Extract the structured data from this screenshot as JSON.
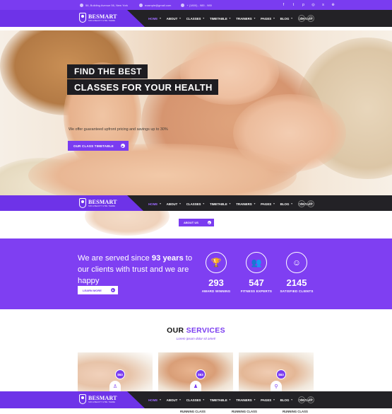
{
  "topbar": {
    "address": "56, Building Avenue 56, New York",
    "email": "example@gmail.com",
    "phone": "+ (1800) - 985 - 985",
    "social_icons": [
      "facebook-icon",
      "twitter-icon",
      "pinterest-icon",
      "instagram-icon",
      "skype-icon",
      "dribbble-icon"
    ]
  },
  "logo": {
    "brand": "BESMART",
    "tagline": "SPA & BEAUTY HTML THEME"
  },
  "nav": {
    "items": [
      {
        "label": "HOME",
        "active": true
      },
      {
        "label": "ABOUT"
      },
      {
        "label": "CLASSES"
      },
      {
        "label": "TIMETABLE"
      },
      {
        "label": "TRAINERS"
      },
      {
        "label": "PAGES"
      },
      {
        "label": "BLOG"
      },
      {
        "label": "CONTACT",
        "no_chevron": true
      }
    ],
    "icons": [
      "search-icon",
      "cart-icon"
    ]
  },
  "hero": {
    "line1": "FIND THE BEST",
    "line2": "CLASSES FOR YOUR HEALTH",
    "subtitle": "We offer guaranteed upfront pricing and savings up to 30%",
    "button": "OUR CLASS TIMETABLE"
  },
  "about": {
    "button": "ABOUT US"
  },
  "stats": {
    "headline_pre": "We are served since ",
    "headline_bold": "93 years",
    "headline_post": " to our clients with trust and we are happy",
    "button": "LEARN MORE",
    "items": [
      {
        "icon": "trophy-icon",
        "value": "293",
        "label": "AWARD WINNING"
      },
      {
        "icon": "team-icon",
        "value": "547",
        "label": "FITNESS EXPERTS"
      },
      {
        "icon": "smile-icon",
        "value": "2145",
        "label": "SATISFIED CLIENTS"
      }
    ]
  },
  "services": {
    "title_plain": "OUR ",
    "title_highlight": "SERVICES",
    "subtitle": "Lorem ipsum dolor sit amet!",
    "cards": [
      {
        "price": "$63",
        "icon": "yoga-icon"
      },
      {
        "price": "$63",
        "icon": "meditation-icon"
      },
      {
        "price": "$63",
        "icon": "fitness-icon"
      }
    ],
    "partial_labels": [
      "RUNNING CLASS",
      "RUNNING CLASS",
      "RUNNING CLASS"
    ]
  },
  "colors": {
    "accent": "#7a3cf0",
    "nav_bg": "#232226",
    "stats_bg": "#7f3ff2"
  }
}
